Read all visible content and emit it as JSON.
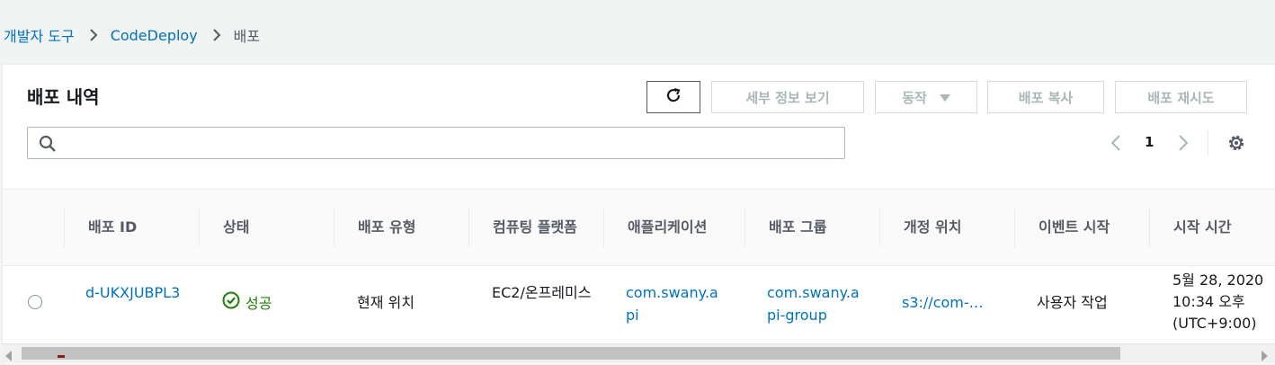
{
  "breadcrumb": {
    "items": [
      "개발자 도구",
      "CodeDeploy"
    ],
    "current": "배포"
  },
  "panel": {
    "title": "배포 내역",
    "buttons": {
      "view_details": "세부 정보 보기",
      "actions": "동작",
      "copy_deployment": "배포 복사",
      "retry_deployment": "배포 재시도"
    },
    "search": {
      "value": "",
      "placeholder": ""
    },
    "pagination": {
      "current_page": "1"
    }
  },
  "table": {
    "columns": [
      "배포 ID",
      "상태",
      "배포 유형",
      "컴퓨팅 플랫폼",
      "애플리케이션",
      "배포 그룹",
      "개정 위치",
      "이벤트 시작",
      "시작 시간"
    ],
    "rows": [
      {
        "deployment_id": "d-UKXJUBPL3",
        "status": "성공",
        "deployment_type": "현재 위치",
        "compute_platform": "EC2/온프레미스",
        "application": "com.swany.api",
        "deployment_group": "com.swany.api-group",
        "revision_location": "s3://com-…",
        "initiating_event": "사용자 작업",
        "start_time": "5월 28, 2020 10:34 오후 (UTC+9:00)"
      }
    ]
  },
  "colors": {
    "link": "#0073bb",
    "success": "#1d8102",
    "disabled_text": "#aab7b8",
    "background": "#f2f3f3"
  }
}
